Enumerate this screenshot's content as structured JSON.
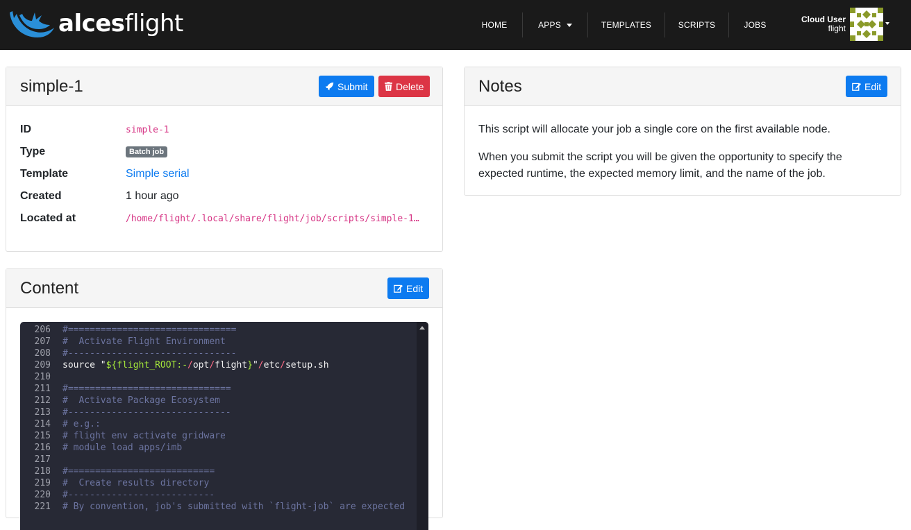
{
  "brand": {
    "name_bold": "alces",
    "name_light": "flight"
  },
  "nav": {
    "items": [
      {
        "label": "HOME"
      },
      {
        "label": "APPS"
      },
      {
        "label": "TEMPLATES"
      },
      {
        "label": "SCRIPTS"
      },
      {
        "label": "JOBS"
      }
    ],
    "user": {
      "name": "Cloud User",
      "username": "flight"
    }
  },
  "script_card": {
    "title": "simple-1",
    "submit_label": "Submit",
    "delete_label": "Delete",
    "fields": [
      {
        "label": "ID",
        "value": "simple-1"
      },
      {
        "label": "Type",
        "value": "Batch job"
      },
      {
        "label": "Template",
        "value": "Simple serial"
      },
      {
        "label": "Created",
        "value": "1 hour ago"
      },
      {
        "label": "Located at",
        "value": "/home/flight/.local/share/flight/job/scripts/simple-1…"
      }
    ]
  },
  "notes_card": {
    "title": "Notes",
    "edit_label": "Edit",
    "paragraphs": [
      "This script will allocate your job a single core on the first available node.",
      "When you submit the script you will be given the opportunity to specify the",
      "expected runtime, the expected memory limit, and the name of the job."
    ]
  },
  "content_card": {
    "title": "Content",
    "edit_label": "Edit",
    "lines": [
      {
        "num": "206",
        "text": "#==============================="
      },
      {
        "num": "207",
        "text": "#  Activate Flight Environment"
      },
      {
        "num": "208",
        "text": "#-------------------------------"
      },
      {
        "num": "209",
        "text": "source \"${flight_ROOT:-/opt/flight}\"/etc/setup.sh"
      },
      {
        "num": "210",
        "text": ""
      },
      {
        "num": "211",
        "text": "#=============================="
      },
      {
        "num": "212",
        "text": "#  Activate Package Ecosystem"
      },
      {
        "num": "213",
        "text": "#------------------------------"
      },
      {
        "num": "214",
        "text": "# e.g.:"
      },
      {
        "num": "215",
        "text": "# flight env activate gridware"
      },
      {
        "num": "216",
        "text": "# module load apps/imb"
      },
      {
        "num": "217",
        "text": ""
      },
      {
        "num": "218",
        "text": "#==========================="
      },
      {
        "num": "219",
        "text": "#  Create results directory"
      },
      {
        "num": "220",
        "text": "#---------------------------"
      },
      {
        "num": "221",
        "text": "# By convention, job's submitted with `flight-job` are expected"
      }
    ]
  },
  "colors": {
    "navbar": "#1a1a1a",
    "primary": "#0d7bf0",
    "danger": "#dc3545",
    "mono_value": "#d63384",
    "code_bg": "#272935"
  }
}
